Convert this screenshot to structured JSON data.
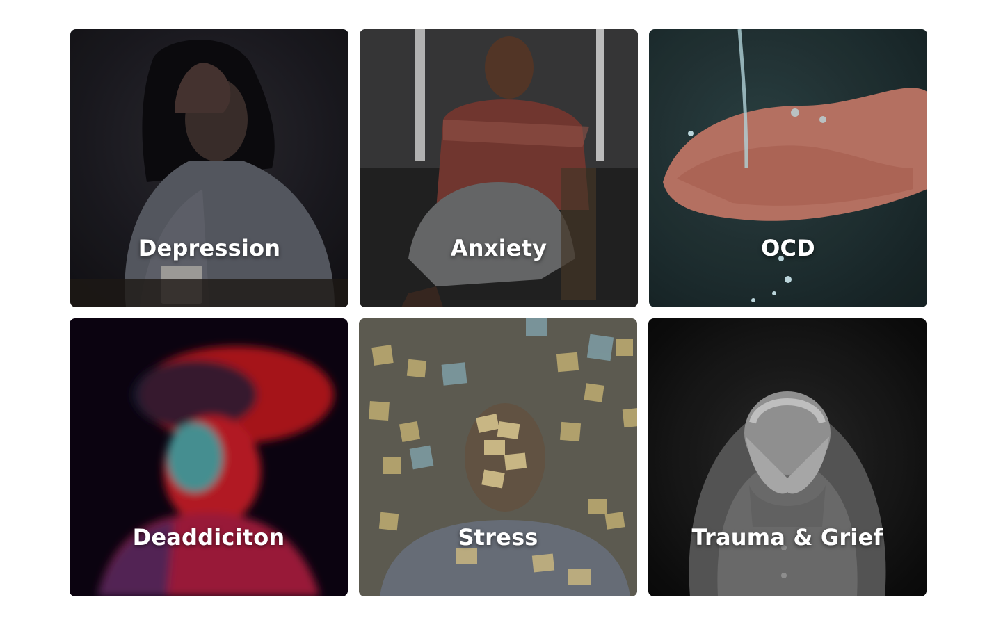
{
  "cards": [
    {
      "label": "Depression",
      "image": "person-head-in-hand-icon"
    },
    {
      "label": "Anxiety",
      "image": "person-hugging-knees-icon"
    },
    {
      "label": "OCD",
      "image": "hands-water-icon"
    },
    {
      "label": "Deaddiciton",
      "image": "blurred-person-icon"
    },
    {
      "label": "Stress",
      "image": "sticky-notes-person-icon"
    },
    {
      "label": "Trauma & Grief",
      "image": "person-covering-face-icon"
    }
  ],
  "colors": {
    "background": "#ffffff",
    "label_text": "#ffffff",
    "depression_bg": "#1e1c22",
    "anxiety_bg": "#2a2a2b",
    "ocd_bg": "#1f3133",
    "deaddiction_bg": "#0d0412",
    "stress_bg": "#3b3a33",
    "trauma_bg": "#111111"
  }
}
